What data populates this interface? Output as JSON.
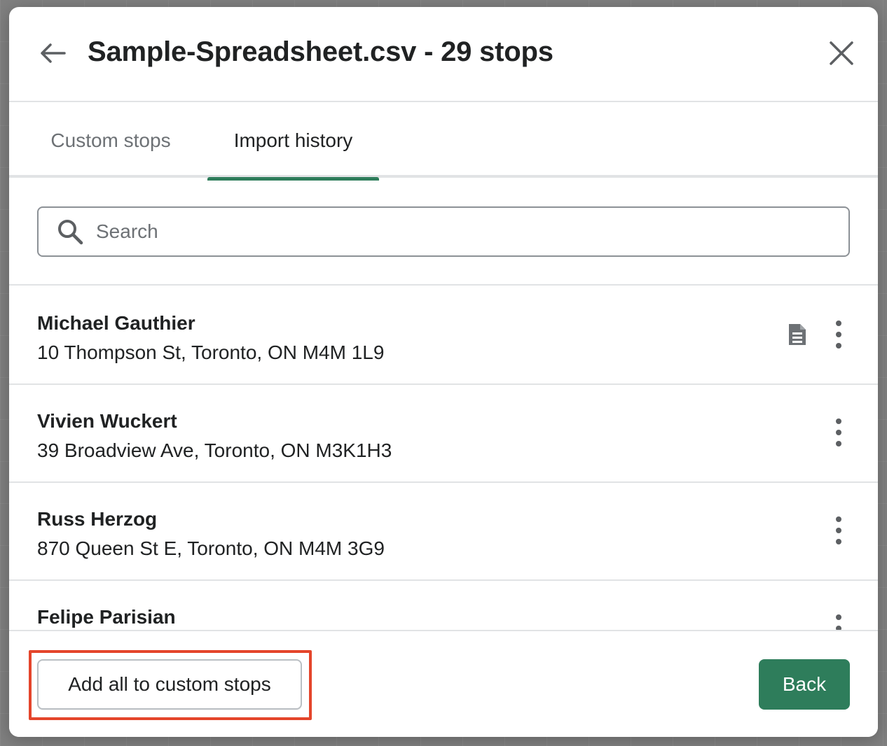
{
  "header": {
    "title": "Sample-Spreadsheet.csv - 29 stops"
  },
  "tabs": [
    {
      "label": "Custom stops",
      "active": false
    },
    {
      "label": "Import history",
      "active": true
    }
  ],
  "search": {
    "placeholder": "Search",
    "value": ""
  },
  "stops": [
    {
      "name": "Michael Gauthier",
      "address": "10 Thompson St, Toronto, ON M4M 1L9",
      "has_note": true
    },
    {
      "name": "Vivien Wuckert",
      "address": "39 Broadview Ave, Toronto, ON M3K1H3",
      "has_note": false
    },
    {
      "name": "Russ Herzog",
      "address": "870 Queen St E, Toronto, ON M4M 3G9",
      "has_note": false
    },
    {
      "name": "Felipe Parisian",
      "address": "",
      "has_note": false
    }
  ],
  "footer": {
    "add_all_label": "Add all to custom stops",
    "back_label": "Back"
  },
  "colors": {
    "accent": "#2e7d5b",
    "highlight": "#e4452b"
  },
  "icons": {
    "back": "arrow-left-icon",
    "close": "close-icon",
    "search": "search-icon",
    "note": "document-icon",
    "more": "more-vertical-icon"
  }
}
